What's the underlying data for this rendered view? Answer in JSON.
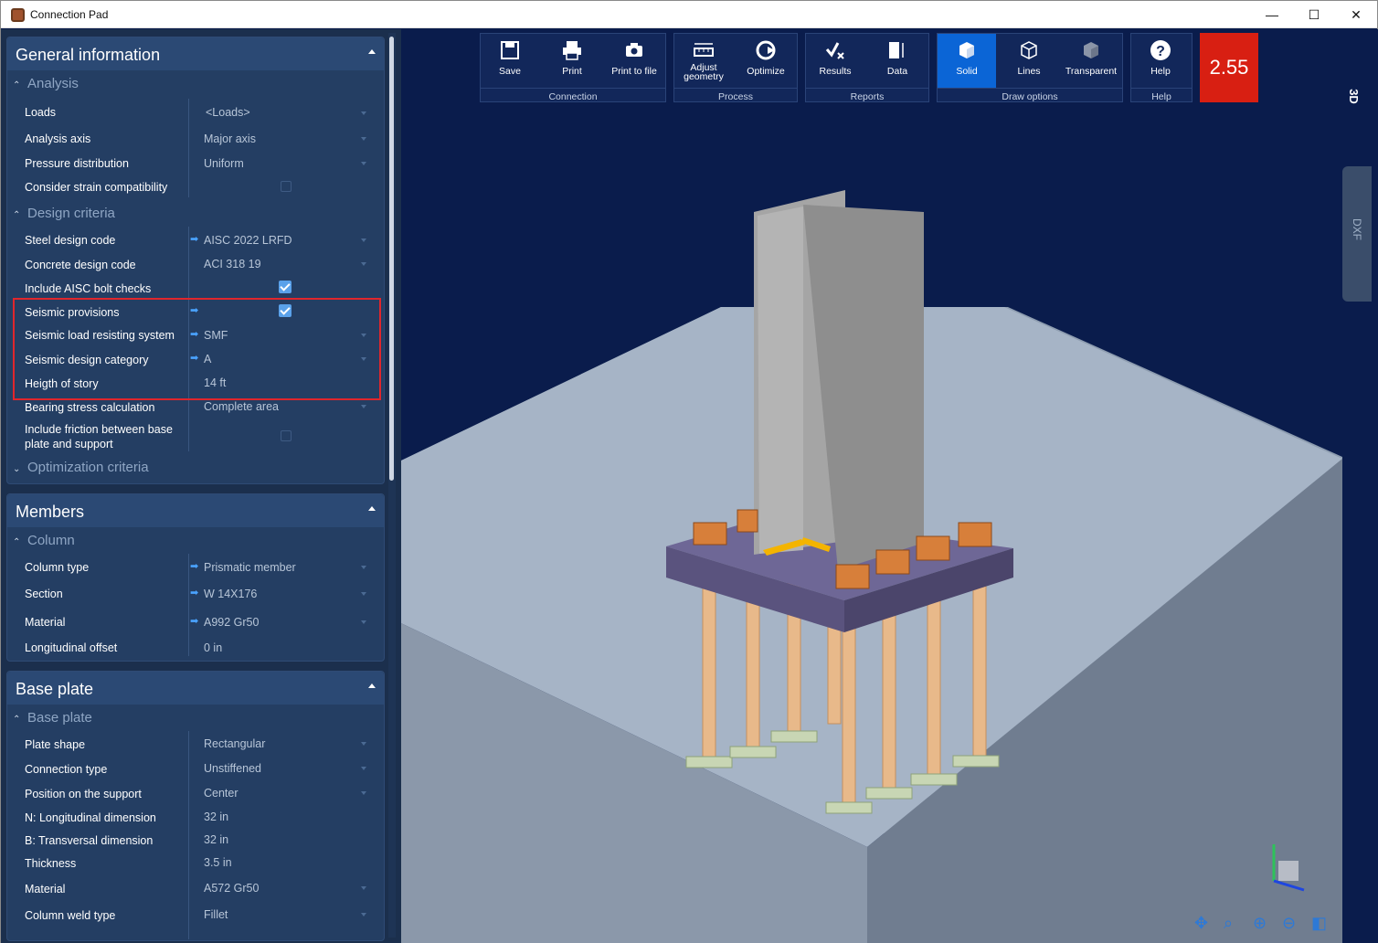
{
  "window": {
    "title": "Connection Pad",
    "minimize": "—",
    "maximize": "☐",
    "close": "✕"
  },
  "panels": {
    "general": {
      "title": "General information",
      "analysis": {
        "label": "Analysis",
        "rows": [
          {
            "label": "Loads",
            "value": "<Loads>"
          },
          {
            "label": "Analysis axis",
            "value": "Major axis"
          },
          {
            "label": "Pressure distribution",
            "value": "Uniform"
          },
          {
            "label": "Consider strain compatibility",
            "checked": false
          }
        ]
      },
      "design": {
        "label": "Design criteria",
        "rows": [
          {
            "label": "Steel design code",
            "value": "AISC 2022 LRFD"
          },
          {
            "label": "Concrete design code",
            "value": "ACI 318 19"
          },
          {
            "label": "Include AISC bolt checks",
            "checked": true
          },
          {
            "label": "Seismic provisions",
            "checked": true
          },
          {
            "label": "Seismic load resisting system",
            "value": "SMF"
          },
          {
            "label": "Seismic design category",
            "value": "A"
          },
          {
            "label": "Heigth of story",
            "value": "14 ft"
          },
          {
            "label": "Bearing stress calculation",
            "value": "Complete area"
          },
          {
            "label": "Include friction between base plate and support",
            "checked": false
          }
        ]
      },
      "optimization": {
        "label": "Optimization criteria"
      }
    },
    "members": {
      "title": "Members",
      "column": {
        "label": "Column",
        "rows": [
          {
            "label": "Column type",
            "value": "Prismatic member"
          },
          {
            "label": "Section",
            "value": "W 14X176"
          },
          {
            "label": "Material",
            "value": "A992 Gr50"
          },
          {
            "label": "Longitudinal offset",
            "value": "0 in"
          }
        ]
      }
    },
    "baseplate": {
      "title": "Base plate",
      "group": {
        "label": "Base plate",
        "rows": [
          {
            "label": "Plate shape",
            "value": "Rectangular"
          },
          {
            "label": "Connection type",
            "value": "Unstiffened"
          },
          {
            "label": "Position on the support",
            "value": "Center"
          },
          {
            "label": "N: Longitudinal dimension",
            "value": "32 in"
          },
          {
            "label": "B: Transversal dimension",
            "value": "32 in"
          },
          {
            "label": "Thickness",
            "value": "3.5 in"
          },
          {
            "label": "Material",
            "value": "A572 Gr50"
          },
          {
            "label": "Column weld type",
            "value": "Fillet"
          }
        ]
      }
    }
  },
  "ribbon": {
    "connection": {
      "label": "Connection",
      "save": "Save",
      "print": "Print",
      "print_to_file": "Print to file"
    },
    "process": {
      "label": "Process",
      "adjust_line1": "Adjust",
      "adjust_line2": "geometry",
      "optimize": "Optimize"
    },
    "reports": {
      "label": "Reports",
      "results": "Results",
      "data": "Data"
    },
    "draw": {
      "label": "Draw options",
      "solid": "Solid",
      "lines": "Lines",
      "transparent": "Transparent"
    },
    "help": {
      "label": "Help",
      "help": "Help"
    },
    "factor": "2.55"
  },
  "side": {
    "view3d": "3D",
    "dxf": "DXF"
  },
  "colors": {
    "accent": "#0b65d6",
    "factor_bg": "#d81f12",
    "highlight": "#e0262c"
  }
}
